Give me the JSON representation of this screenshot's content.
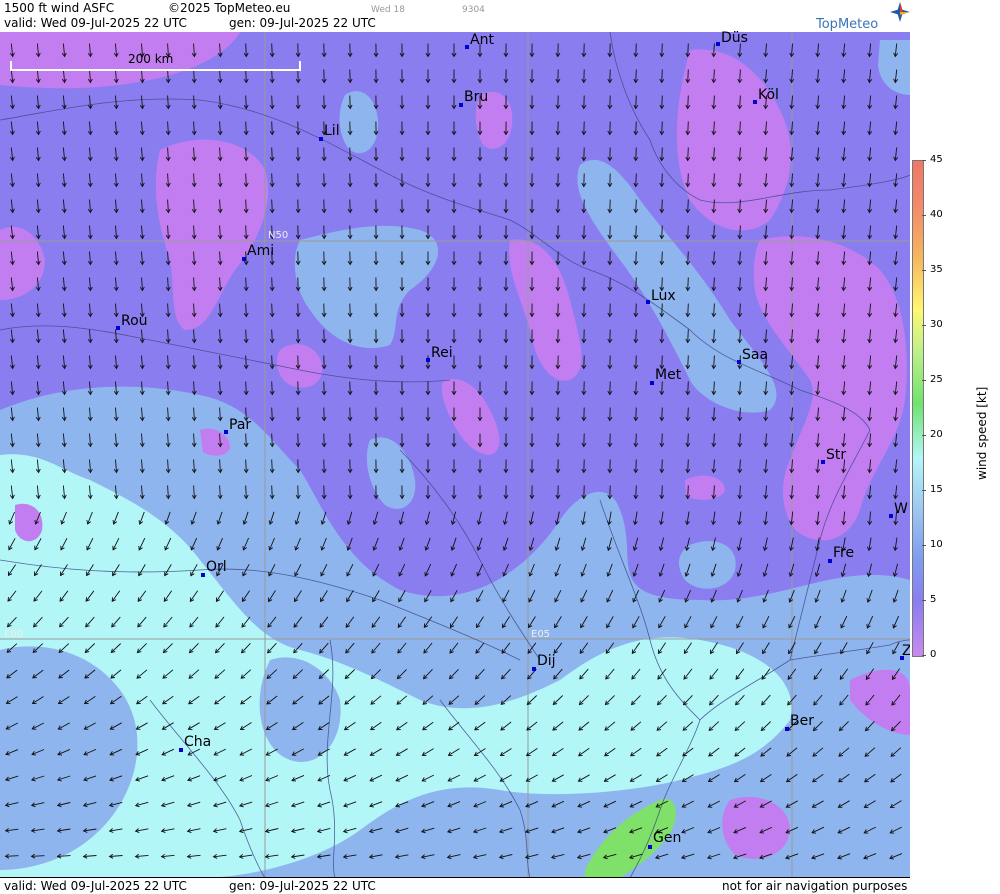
{
  "header": {
    "title": "1500 ft wind ASFC",
    "copyright": "©2025 TopMeteo.eu",
    "day_tag": "Wed 18",
    "code_tag": "9304",
    "valid": "valid:  Wed  09-Jul-2025  22 UTC",
    "generated": "gen: 09-Jul-2025 22 UTC",
    "logo": "TopMeteo"
  },
  "footer": {
    "valid": "valid:  Wed  09-Jul-2025  22 UTC",
    "generated": "gen: 09-Jul-2025 22 UTC",
    "disclaimer": "not for air navigation purposes"
  },
  "scale": {
    "label": "200 km"
  },
  "grid_labels": {
    "lat": "N50",
    "lon0": "E00",
    "lon5": "E05"
  },
  "legend": {
    "axis_label": "wind  speed  [kt]",
    "ticks": [
      "45",
      "40",
      "35",
      "30",
      "25",
      "20",
      "15",
      "10",
      "5",
      "0"
    ],
    "colors": [
      "#ee7866",
      "#f7b860",
      "#fff870",
      "#c2f08a",
      "#6fe36f",
      "#b3f6f8",
      "#9cc4f0",
      "#8a7df0",
      "#c98bf0"
    ]
  },
  "cities": [
    {
      "name": "Ant"
    },
    {
      "name": "Düs"
    },
    {
      "name": "Köl"
    },
    {
      "name": "Bru"
    },
    {
      "name": "Lil"
    },
    {
      "name": "Ami"
    },
    {
      "name": "Rou"
    },
    {
      "name": "Lux"
    },
    {
      "name": "Rei"
    },
    {
      "name": "Saa"
    },
    {
      "name": "Met"
    },
    {
      "name": "Par"
    },
    {
      "name": "Str"
    },
    {
      "name": "W"
    },
    {
      "name": "Fre"
    },
    {
      "name": "Orl"
    },
    {
      "name": "Dij"
    },
    {
      "name": "Ber"
    },
    {
      "name": "Cha"
    },
    {
      "name": "Gen"
    },
    {
      "name": "Z"
    }
  ],
  "map_colors": {
    "purple": "#8a7df0",
    "violet": "#c27ef0",
    "blue": "#8fb5ef",
    "cyan": "#b3f6f8",
    "green": "#7fe06a"
  }
}
